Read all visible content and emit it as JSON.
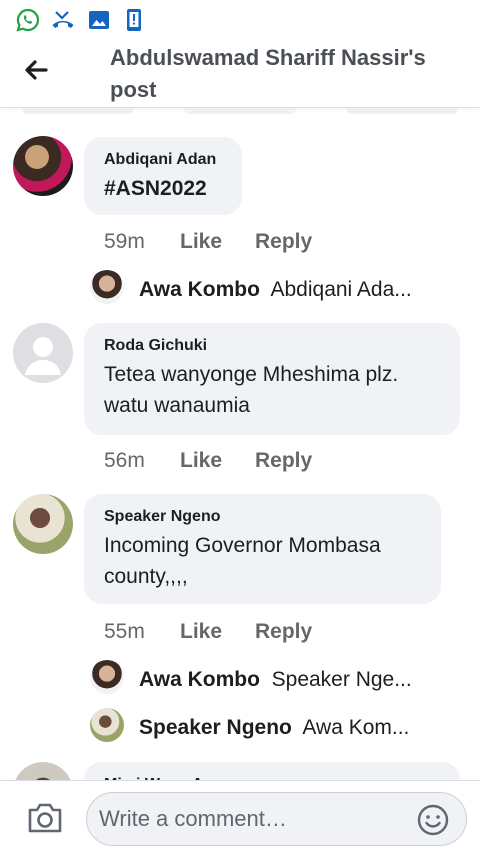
{
  "header": {
    "title": "Abdulswamad Shariff Nassir's post"
  },
  "comments": [
    {
      "author": "Abdiqani Adan",
      "text": "#ASN2022",
      "time": "59m",
      "like": "Like",
      "reply": "Reply",
      "reply_preview": {
        "author": "Awa Kombo",
        "text": "Abdiqani Ada..."
      }
    },
    {
      "author": "Roda Gichuki",
      "text": "Tetea wanyonge Mheshima plz. watu wanaumia",
      "time": "56m",
      "like": "Like",
      "reply": "Reply"
    },
    {
      "author": "Speaker Ngeno",
      "text": "Incoming Governor Mombasa county,,,,",
      "time": "55m",
      "like": "Like",
      "reply": "Reply",
      "reply_previews": [
        {
          "author": "Awa Kombo",
          "text": "Speaker Nge..."
        },
        {
          "author": "Speaker Ngeno",
          "text": "Awa Kom..."
        }
      ]
    },
    {
      "author": "Mimi Wanu Aggreys"
    }
  ],
  "composer": {
    "placeholder": "Write a comment…"
  },
  "icons": {
    "status": [
      "whatsapp-icon",
      "missed-call-icon",
      "gallery-icon",
      "phone-storage-icon"
    ],
    "back": "back-arrow-icon",
    "camera": "camera-icon",
    "emoji": "emoji-icon"
  },
  "colors": {
    "accent": "#1877f2",
    "bubble": "#f0f2f5",
    "secondary_text": "#65676b"
  }
}
